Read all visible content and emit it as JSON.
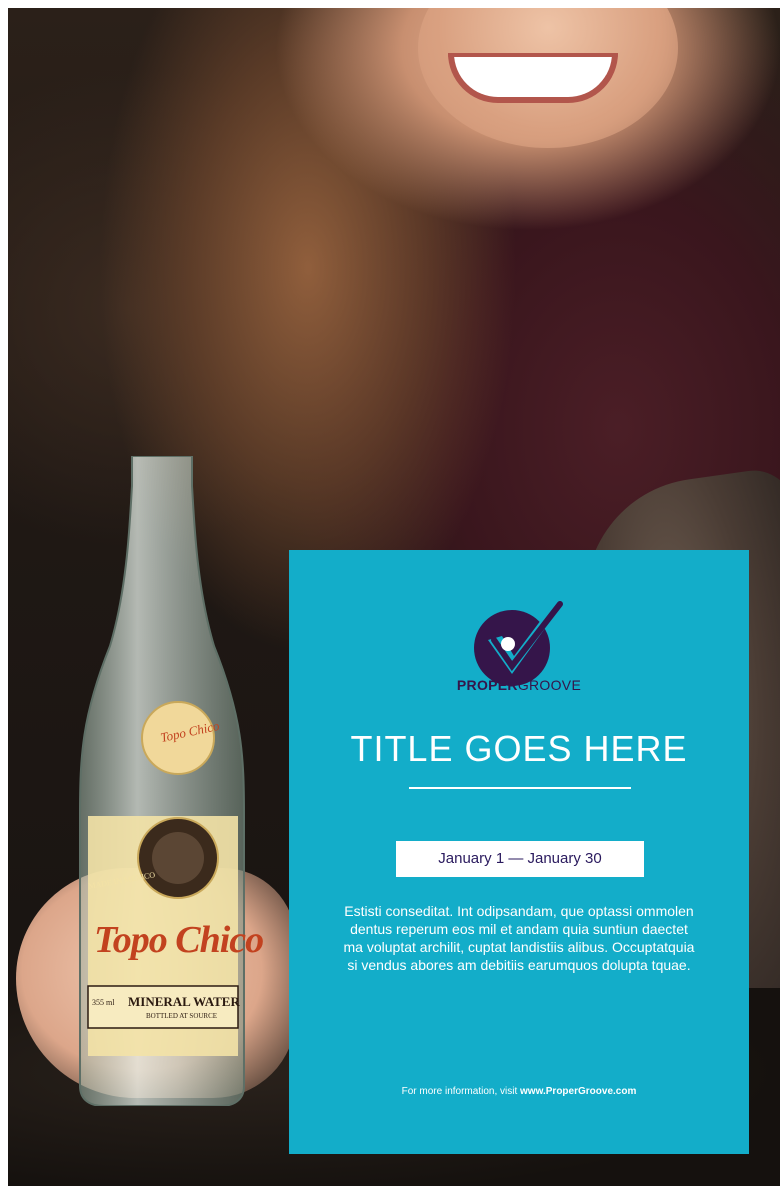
{
  "photo": {
    "bottle_brand": "Topo Chico",
    "bottle_badge_left": "MADE IN MEXICO",
    "bottle_product": "MINERAL WATER",
    "bottle_volume": "355 ml",
    "bottle_sub": "BOTTLED AT SOURCE"
  },
  "panel": {
    "logo": "propergroove-checkmark-logo",
    "brand_bold": "PROPER",
    "brand_regular": "GROOVE",
    "title": "TITLE GOES HERE",
    "date_range": "January 1 — January 30",
    "body": "Estisti conseditat. Int odipsandam, que optassi ommolen dentus reperum eos mil et andam quia suntiun daectet ma voluptat archilit, cuptat landistiis alibus. Occuptatquia si vendus abores am debitiis earumquos dolupta tquae.",
    "more_info_prefix": "For more information, visit ",
    "more_info_url": "www.ProperGroove.com"
  },
  "colors": {
    "panel_bg": "#13adc9",
    "brand_purple": "#35154a",
    "date_text": "#2a1a5e"
  }
}
